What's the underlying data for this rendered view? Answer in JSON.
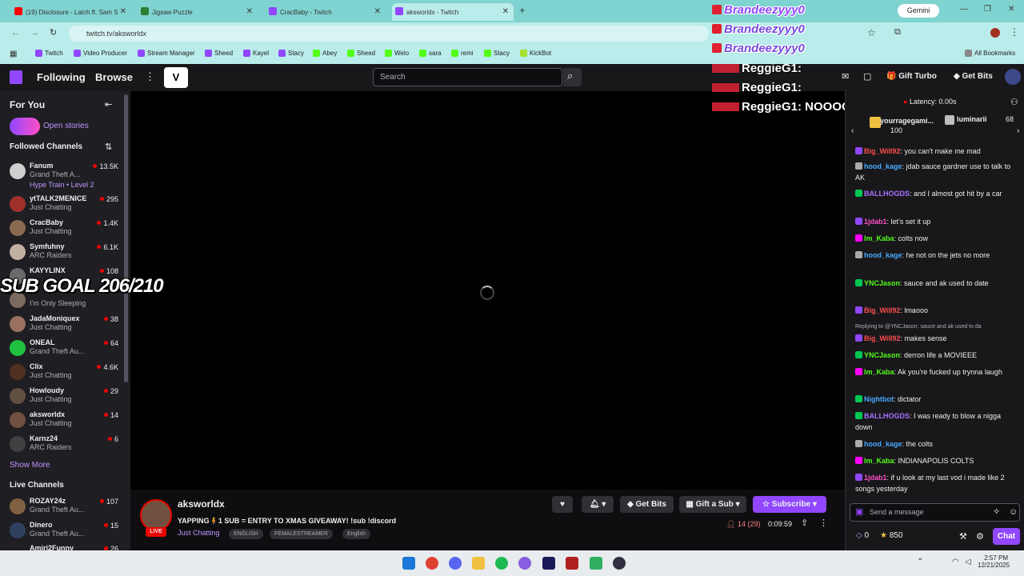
{
  "browser": {
    "tabs": [
      {
        "label": "(19) Disclosure - Latch ft. Sam S",
        "color": "#ff0000"
      },
      {
        "label": "Jigsaw Puzzle",
        "color": "#2e7d32"
      },
      {
        "label": "CracBaby - Twitch",
        "color": "#9147ff"
      },
      {
        "label": "aksworldx - Twitch",
        "color": "#9147ff"
      }
    ],
    "new_tab": "+",
    "gemini": "Gemini",
    "url": "twitch.tv/aksworldx",
    "bookmarks": [
      {
        "label": "Twitch",
        "color": "#9147ff"
      },
      {
        "label": "Video Producer",
        "color": "#9147ff"
      },
      {
        "label": "Stream Manager",
        "color": "#9147ff"
      },
      {
        "label": "Sheed",
        "color": "#9147ff"
      },
      {
        "label": "Kayel",
        "color": "#9147ff"
      },
      {
        "label": "Stacy",
        "color": "#9147ff"
      },
      {
        "label": "Abey",
        "color": "#53fc18"
      },
      {
        "label": "Sheed",
        "color": "#53fc18"
      },
      {
        "label": "Welo",
        "color": "#53fc18"
      },
      {
        "label": "sara",
        "color": "#53fc18"
      },
      {
        "label": "remi",
        "color": "#53fc18"
      },
      {
        "label": "Stacy",
        "color": "#53fc18"
      },
      {
        "label": "KickBot",
        "color": "#53fc18"
      }
    ],
    "all_bookmarks": "All Bookmarks"
  },
  "nav": {
    "following": "Following",
    "browse": "Browse",
    "search_placeholder": "Search",
    "gift_turbo": "Gift Turbo",
    "get_bits": "Get Bits"
  },
  "sidebar": {
    "for_you": "For You",
    "open_stories": "Open stories",
    "followed_channels": "Followed Channels",
    "channels": [
      {
        "name": "Fanum",
        "game": "Grand Theft A...",
        "viewers": "13.5K",
        "extra": "Hype Train • Level 2",
        "color": "#cfcfcf"
      },
      {
        "name": "ytTALK2MENICE",
        "game": "Just Chatting",
        "viewers": "295",
        "color": "#a0302a"
      },
      {
        "name": "CracBaby",
        "game": "Just Chatting",
        "viewers": "1.4K",
        "color": "#8a6a50"
      },
      {
        "name": "Symfuhny",
        "game": "ARC Raiders",
        "viewers": "6.1K",
        "color": "#c0b0a0"
      },
      {
        "name": "KAYYLINX",
        "game": "",
        "viewers": "108",
        "color": "#6a6a6a"
      },
      {
        "name": "",
        "game": "I'm Only Sleeping",
        "viewers": "",
        "color": "#7a6a60"
      },
      {
        "name": "JadaMoniquex",
        "game": "Just Chatting",
        "viewers": "38",
        "color": "#9a7060"
      },
      {
        "name": "ONEAL",
        "game": "Grand Theft Au...",
        "viewers": "64",
        "color": "#20c040"
      },
      {
        "name": "Clix",
        "game": "Just Chatting",
        "viewers": "4.6K",
        "color": "#503020"
      },
      {
        "name": "Howloudy",
        "game": "Just Chatting",
        "viewers": "29",
        "color": "#605040"
      },
      {
        "name": "aksworldx",
        "game": "Just Chatting",
        "viewers": "14",
        "color": "#705040"
      },
      {
        "name": "Karnz24",
        "game": "ARC Raiders",
        "viewers": "6",
        "color": "#404040"
      }
    ],
    "show_more": "Show More",
    "live_channels": "Live Channels",
    "live": [
      {
        "name": "ROZAY24z",
        "game": "Grand Theft Au...",
        "viewers": "107",
        "color": "#806040"
      },
      {
        "name": "Dinero",
        "game": "Grand Theft Au...",
        "viewers": "15",
        "color": "#304060"
      },
      {
        "name": "Amiri2Funny",
        "game": "",
        "viewers": "26",
        "color": "#604030"
      }
    ]
  },
  "overlay": {
    "sub_goal": "SUB GOAL 206/210",
    "alerts_brand": [
      "Brandeezyyy0",
      "Brandeezyyy0",
      "Brandeezyyy0"
    ],
    "alerts_reggie": [
      "ReggieG1:",
      "ReggieG1:",
      "ReggieG1: NOOOOOOOO"
    ]
  },
  "stream": {
    "channel": "aksworldx",
    "title": "YAPPING🧍1 SUB = ENTRY TO XMAS GIVEAWAY! !sub !discord",
    "live_label": "LIVE",
    "category": "Just Chatting",
    "tags": [
      "ENGLISH",
      "FEMALESTREAMER",
      "English"
    ],
    "get_bits": "Get Bits",
    "gift_sub": "Gift a Sub",
    "subscribe": "Subscribe",
    "viewers": "14 (29)",
    "uptime": "0:09:59"
  },
  "chat": {
    "latency": "Latency: 0.00s",
    "leaders": [
      {
        "name": "yourragegami...",
        "value": "100"
      },
      {
        "name": "luminarii",
        "value": "68"
      }
    ],
    "messages": [
      {
        "user": "Big_Will92",
        "color": "#ff4f4f",
        "text": ": you can't make me mad",
        "badge": "#9147ff"
      },
      {
        "user": "hood_kage",
        "color": "#4aa8ff",
        "text": ": jdab sauce gardner use to talk to AK",
        "badge": "#aaaaaa"
      },
      {
        "user": "BALLHOGDS",
        "color": "#a970ff",
        "text": ": and I almost got hit by a car",
        "badge": "#00c853"
      },
      {
        "user": "1jdab1",
        "color": "#ff4fc8",
        "text": ": let's set it up",
        "badge": "#9147ff"
      },
      {
        "user": "Im_Kaba",
        "color": "#53fc18",
        "text": ": colts now",
        "badge": "#ff00ff"
      },
      {
        "user": "hood_kage",
        "color": "#4aa8ff",
        "text": ": he not on the jets no more",
        "badge": "#aaaaaa"
      },
      {
        "user": "YNCJason",
        "color": "#53fc18",
        "text": ": sauce and ak used to date",
        "badge": "#00c853"
      },
      {
        "user": "Big_Will92",
        "color": "#ff4f4f",
        "text": ": lmaooo",
        "badge": "#9147ff"
      },
      {
        "user": "",
        "color": "#adadb8",
        "text": "Replying to @YNCJason: sauce and ak used to da",
        "badge": ""
      },
      {
        "user": "Big_Will92",
        "color": "#ff4f4f",
        "text": ": makes sense",
        "badge": "#9147ff"
      },
      {
        "user": "YNCJason",
        "color": "#53fc18",
        "text": ": derron life a MOVIEEE",
        "badge": "#00c853"
      },
      {
        "user": "Im_Kaba",
        "color": "#53fc18",
        "text": ": Ak you're fucked up trynna laugh",
        "badge": "#ff00ff"
      },
      {
        "user": "Nightbot",
        "color": "#4aa8ff",
        "text": ": dictator",
        "badge": "#00c853"
      },
      {
        "user": "BALLHOGDS",
        "color": "#a970ff",
        "text": ": I was ready to blow a nigga down",
        "badge": "#00c853"
      },
      {
        "user": "hood_kage",
        "color": "#4aa8ff",
        "text": ": the colts",
        "badge": "#aaaaaa"
      },
      {
        "user": "Im_Kaba",
        "color": "#53fc18",
        "text": ": INDIANAPOLIS COLTS",
        "badge": "#ff00ff"
      },
      {
        "user": "1jdab1",
        "color": "#ff4fc8",
        "text": ": if u look at my last vod i made like 2 songs yesterday",
        "badge": "#9147ff"
      }
    ],
    "input_placeholder": "Send a message",
    "points": "0",
    "bits": "850",
    "chat_button": "Chat"
  },
  "taskbar": {
    "time": "2:57 PM",
    "date": "12/21/2025"
  }
}
